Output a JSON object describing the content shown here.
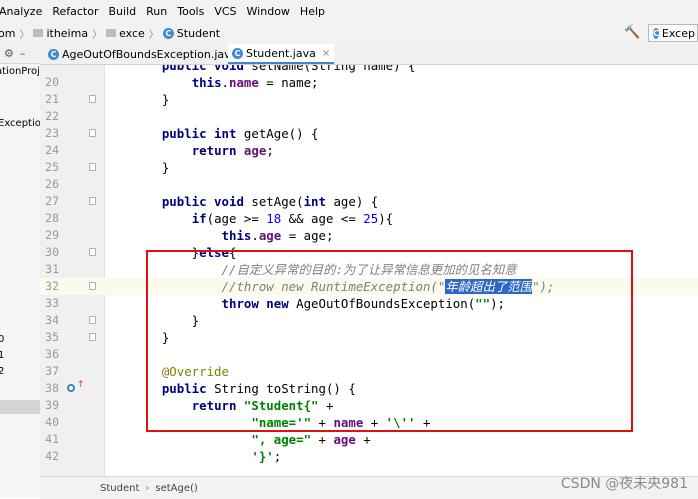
{
  "menu": [
    "Analyze",
    "Refactor",
    "Build",
    "Run",
    "Tools",
    "VCS",
    "Window",
    "Help"
  ],
  "breadcrumb": {
    "items": [
      "om",
      "itheima",
      "exce",
      "Student"
    ]
  },
  "run_config": "Excep",
  "left_panel": {
    "texts": [
      "ationProje",
      "Exceptio",
      "0",
      "1",
      "2"
    ]
  },
  "tabs": [
    {
      "label": "AgeOutOfBoundsException.java",
      "close": "×"
    },
    {
      "label": "Student.java",
      "close": "×"
    }
  ],
  "editor": {
    "lines": [
      {
        "num": "20",
        "html": "        <span class='kw'>this</span>.<span class='fld'>name</span> = name;"
      },
      {
        "num": "21",
        "html": "    }"
      },
      {
        "num": "22",
        "html": ""
      },
      {
        "num": "23",
        "html": "    <span class='kw'>public int</span> getAge() {"
      },
      {
        "num": "24",
        "html": "        <span class='kw'>return</span> <span class='fld'>age</span>;"
      },
      {
        "num": "25",
        "html": "    }"
      },
      {
        "num": "26",
        "html": ""
      },
      {
        "num": "27",
        "html": "    <span class='kw'>public void</span> setAge(<span class='kw'>int</span> age) {"
      },
      {
        "num": "28",
        "html": "        <span class='kw'>if</span>(age >= <span class='num'>18</span> && age <= <span class='num'>25</span>){"
      },
      {
        "num": "29",
        "html": "            <span class='kw'>this</span>.<span class='fld'>age</span> = age;"
      },
      {
        "num": "30",
        "html": "        }<span class='kw'>else</span>{"
      },
      {
        "num": "31",
        "html": "            <span class='cmt'>//自定义异常的目的:为了让异常信息更加的见名知意</span>"
      },
      {
        "num": "32",
        "html": "            <span class='cmt'>//throw new RuntimeException(\"<span class='sel'>年龄超出了范围</span>\");</span>"
      },
      {
        "num": "33",
        "html": "            <span class='kw'>throw new</span> AgeOutOfBoundsException(<span class='str'>\"\"</span>);"
      },
      {
        "num": "34",
        "html": "        }"
      },
      {
        "num": "35",
        "html": "    }"
      },
      {
        "num": "36",
        "html": ""
      },
      {
        "num": "37",
        "html": "    <span class='ann'>@Override</span>"
      },
      {
        "num": "38",
        "html": "    <span class='kw'>public</span> String toString() {"
      },
      {
        "num": "39",
        "html": "        <span class='kw'>return</span> <span class='str'>\"Student{\"</span> +"
      },
      {
        "num": "40",
        "html": "                <span class='str'>\"name='\"</span> + <span class='fld'>name</span> + <span class='str'>'\\''</span> +"
      },
      {
        "num": "41",
        "html": "                <span class='str'>\", age=\"</span> + <span class='fld'>age</span> +"
      },
      {
        "num": "42",
        "html": "                <span class='str'>'}'</span>;"
      }
    ],
    "top_partial": "    <span class='kw'>public void</span> setName(String name) {"
  },
  "status": {
    "crumbs": [
      "Student",
      "setAge()"
    ]
  },
  "watermark": "CSDN @夜未央981",
  "colors": {
    "keyword": "#000080",
    "field": "#660e7a",
    "number": "#0000ff",
    "string": "#008000",
    "comment": "#808080",
    "highlight_box": "#e01010"
  }
}
